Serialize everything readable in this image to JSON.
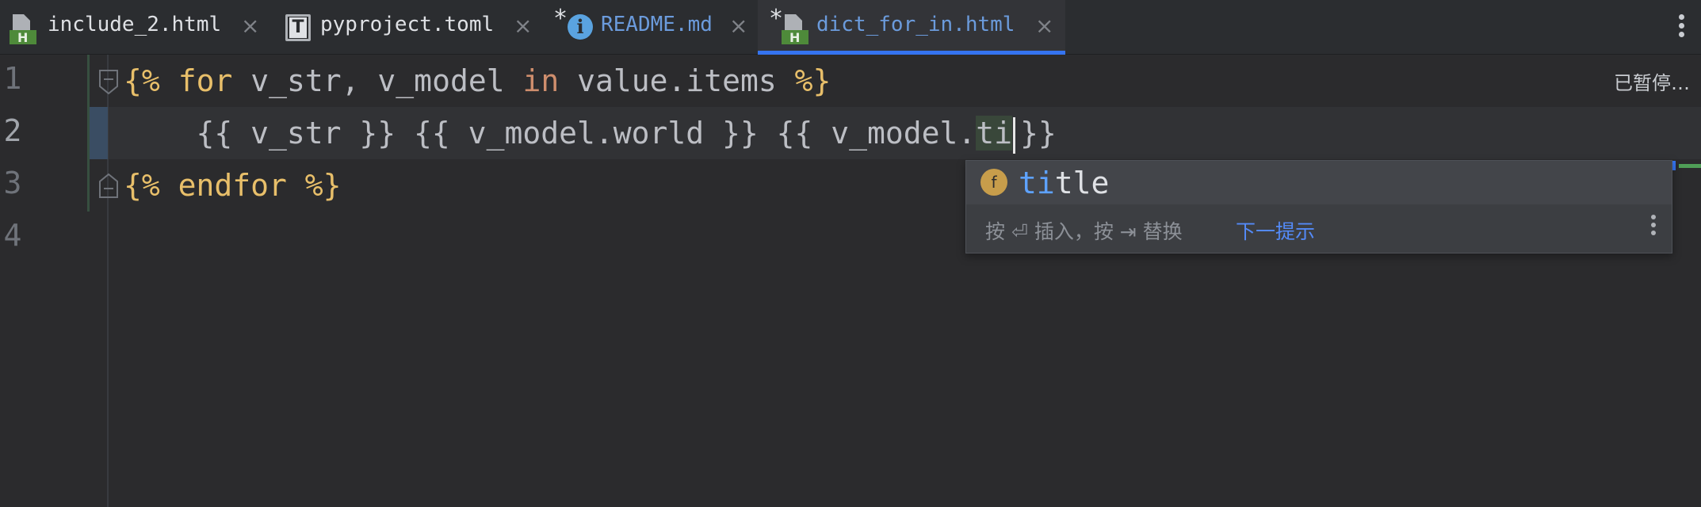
{
  "tabs": [
    {
      "name": "include_2.html",
      "icon": "html-file-icon",
      "modified": false,
      "active": false
    },
    {
      "name": "pyproject.toml",
      "icon": "toml-file-icon",
      "modified": false,
      "active": false
    },
    {
      "name": "README.md",
      "icon": "info-icon",
      "modified": true,
      "active": false
    },
    {
      "name": "dict_for_in.html",
      "icon": "html-file-icon",
      "modified": true,
      "active": true
    }
  ],
  "modified_mark": "*",
  "close_glyph": "×",
  "status": {
    "paused": "已暂停…"
  },
  "editor": {
    "line_numbers": [
      "1",
      "2",
      "3",
      "4"
    ],
    "current_line": 2,
    "lines": {
      "l1": {
        "open": "{%",
        "kw_for": "for",
        "vars": " v_str, v_model ",
        "kw_in": "in",
        "expr": " value.items ",
        "close": "%}"
      },
      "l2": {
        "indent": "    ",
        "part1": "{{ v_str }} {{ v_model.world }} {{ v_model.",
        "typed": "ti",
        "part2": "}}"
      },
      "l3": {
        "open": "{%",
        "kw": " endfor ",
        "close": "%}"
      }
    }
  },
  "completion": {
    "icon": "f",
    "match": "ti",
    "rest": "tle",
    "hint": "按 ⏎ 插入，按 ⇥ 替换",
    "next_tip": "下一提示"
  },
  "colors": {
    "accent": "#3574f0",
    "template_tag": "#e8bf6a",
    "keyword_in": "#cf8e6d",
    "identifier": "#bcbec4",
    "completion_match": "#5ea2ff"
  }
}
